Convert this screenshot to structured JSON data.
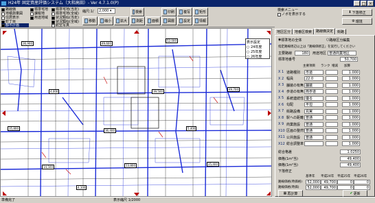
{
  "window": {
    "title": "H24年 固定資産評価システム（大和高田）- Ver 4.7.1.0(P)",
    "min": "_",
    "max": "□",
    "close": "×"
  },
  "layers": [
    "路線価",
    "地積測量図",
    "住居表示",
    "町丁目",
    "都市計画",
    "標準宅地",
    "課税地",
    "用途地域"
  ],
  "layers2": [
    "標準宅地(当年)",
    "標準宅地(全域)",
    "状況類似(当年)",
    "状況類似(全域)",
    "航空写真"
  ],
  "scale": {
    "label": "縮尺:1/",
    "value": "2,000"
  },
  "toolbar": {
    "move": "移動",
    "zoom_in": "拡大",
    "zoom_out": "縮小",
    "measure": "測距",
    "area": "面積",
    "search": "検索",
    "print": "印刷",
    "layer": "図層",
    "copy": "複写",
    "setting": "設定",
    "rect": "矩形",
    "info": "情報"
  },
  "panel": {
    "search_header": "検索メニュー",
    "search_check": "ノボを表示する",
    "btn_revise": "下落修正",
    "btn_env": "環境"
  },
  "tabs": [
    "地区区分",
    "地番区検索",
    "路線価決定",
    "街路"
  ],
  "radio": {
    "one": "標準地の全体",
    "two": "路線区分編集"
  },
  "instruct": "指定路線周辺以上は「路線価修正」を実行してください",
  "fields": {
    "route_no_l": "主要路線",
    "route_no": "180",
    "area_l": "用途地区",
    "area": "普通商業地区",
    "std_l": "標準地番号",
    "std_val": "50,700"
  },
  "cols": [
    "",
    "主要項目",
    "ランク",
    "増減",
    "加算"
  ],
  "rows": [
    {
      "n": "X 1",
      "l": "道路種別",
      "v": "市道",
      "r": "1.000"
    },
    {
      "n": "X 2",
      "l": "幅員",
      "v": "22.0",
      "r": "1.000"
    },
    {
      "n": "X 3",
      "l": "舗装の有無",
      "v": "舗装",
      "r": "1.000"
    },
    {
      "n": "X 4",
      "l": "歩道の有無",
      "v": "両歩道",
      "r": "1.000"
    },
    {
      "n": "X 5",
      "l": "系統連続性",
      "v": "優る",
      "r": "1.000"
    },
    {
      "n": "X 6",
      "l": "勾配",
      "v": "平坦",
      "r": "1.000"
    },
    {
      "n": "X 7",
      "l": "街路設備",
      "v": "充実",
      "r": "1.000"
    },
    {
      "n": "X 8",
      "l": "駅への距離",
      "v": "普通",
      "r": "1.000"
    },
    {
      "n": "X 9",
      "l": "商業施設",
      "v": "普通",
      "r": "1.000"
    },
    {
      "n": "X10",
      "l": "区画の整然性",
      "v": "普通",
      "r": "1.000"
    },
    {
      "n": "X11",
      "l": "公共施設",
      "v": "普通",
      "r": "1.000"
    },
    {
      "n": "X12",
      "l": "総合調整率",
      "v": "",
      "r": "1.000"
    }
  ],
  "summary": {
    "label": "総合格差",
    "value": "1.0250",
    "rate_l": "価格(1m²当)",
    "rate": "49,400",
    "adj_l": "価格(1m²当)",
    "adj": "49,400"
  },
  "compare": {
    "title": "下落修正",
    "head": [
      "基準年",
      "平成24年",
      "平成25年",
      "平成26年"
    ],
    "r1l": "路線価格(時価格)",
    "r1": [
      "52,000",
      "49,700",
      "0",
      "0"
    ],
    "r2l": "路線価格(時価)",
    "r2": [
      "52,000",
      "49,700",
      "0",
      "0"
    ]
  },
  "btns": {
    "recalc": "再計算",
    "update": "更新"
  },
  "status": {
    "left": "準備完了",
    "mid": "表示縮尺 1/2000"
  },
  "scale_box": {
    "title": "表示設定",
    "o1": "24年度",
    "o2": "25年度",
    "o3": "26年度"
  },
  "map_labels": [
    "36,900",
    "49,600",
    "52,000",
    "49,700",
    "4,000",
    "39,500",
    "35,800",
    "36,400",
    "5,400",
    "14,500",
    "13,800",
    "25,400",
    "4,100"
  ]
}
